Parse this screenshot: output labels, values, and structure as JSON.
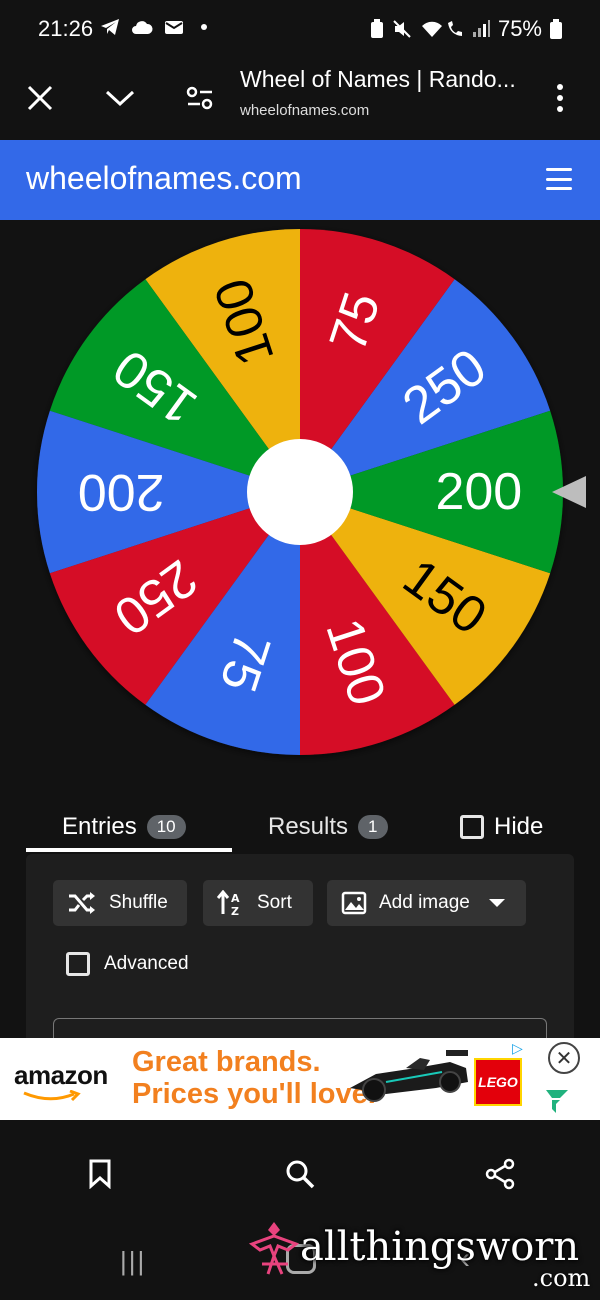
{
  "status_bar": {
    "time": "21:26",
    "battery": "75%",
    "left_icons": [
      "telegram-icon",
      "cloud-icon",
      "mail-icon",
      "dot-icon"
    ],
    "right_icons": [
      "battery-saver-icon",
      "mute-icon",
      "wifi-call-icon",
      "signal-icon",
      "battery-icon"
    ]
  },
  "browser": {
    "title": "Wheel of Names | Rando...",
    "url": "wheelofnames.com"
  },
  "site": {
    "name": "wheelofnames.com",
    "accent": "#3369e8"
  },
  "wheel": {
    "center_color": "#ffffff",
    "pointer_color": "#bdbdbd",
    "segments": [
      {
        "label": "250",
        "color": "#3369e8"
      },
      {
        "label": "75",
        "color": "#d50f25"
      },
      {
        "label": "100",
        "color": "#eeb211"
      },
      {
        "label": "150",
        "color": "#009925"
      },
      {
        "label": "200",
        "color": "#3369e8"
      },
      {
        "label": "250",
        "color": "#d50f25"
      },
      {
        "label": "75",
        "color": "#3369e8"
      },
      {
        "label": "100",
        "color": "#d50f25"
      },
      {
        "label": "150",
        "color": "#eeb211"
      },
      {
        "label": "200",
        "color": "#009925"
      }
    ]
  },
  "tabs": {
    "entries_label": "Entries",
    "entries_count": "10",
    "results_label": "Results",
    "results_count": "1",
    "hide_label": "Hide"
  },
  "panel": {
    "shuffle_label": "Shuffle",
    "sort_label": "Sort",
    "add_image_label": "Add image",
    "advanced_label": "Advanced"
  },
  "ad": {
    "brand": "amazon",
    "headline_1": "Great brands.",
    "headline_2": "Prices you'll love.",
    "lego": "LEGO"
  },
  "watermark": {
    "text": "allthingsworn",
    "suffix": ".com"
  }
}
